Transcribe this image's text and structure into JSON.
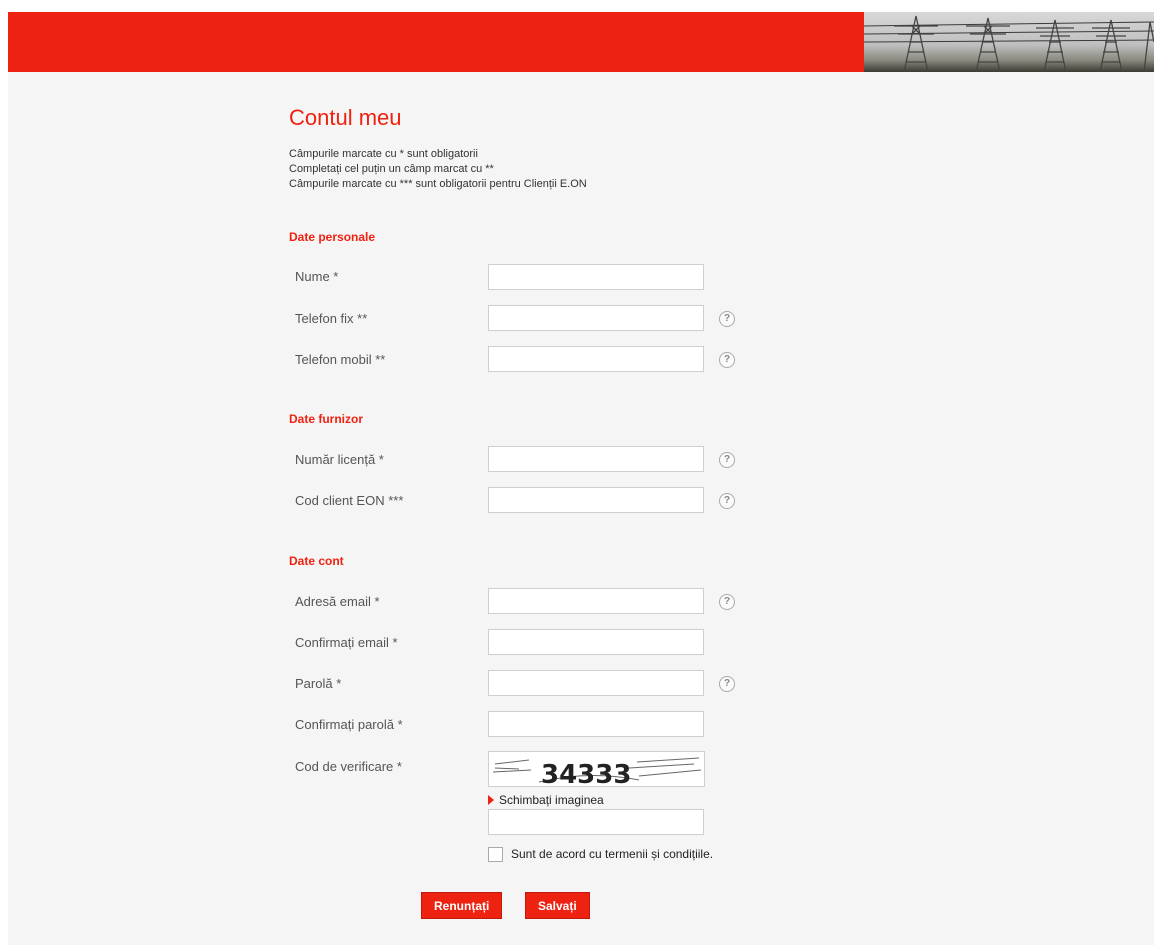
{
  "colors": {
    "brand_red": "#ee2211",
    "page_bg": "#f5f5f5"
  },
  "title": "Contul meu",
  "notes": [
    "Câmpurile marcate cu * sunt obligatorii",
    "Completați cel puțin un câmp marcat cu **",
    "Câmpurile marcate cu *** sunt obligatorii pentru Clienții E.ON"
  ],
  "sections": {
    "personal": "Date personale",
    "supplier": "Date furnizor",
    "account": "Date cont"
  },
  "fields": {
    "nume": {
      "label": "Nume *",
      "value": ""
    },
    "telefon_fix": {
      "label": "Telefon fix **",
      "value": ""
    },
    "telefon_mobil": {
      "label": "Telefon mobil **",
      "value": ""
    },
    "numar_licenta": {
      "label": "Număr licență *",
      "value": ""
    },
    "cod_client": {
      "label": "Cod client EON ***",
      "value": ""
    },
    "email": {
      "label": "Adresă email *",
      "value": ""
    },
    "confirm_email": {
      "label": "Confirmați email *",
      "value": ""
    },
    "parola": {
      "label": "Parolă *",
      "value": ""
    },
    "confirm_parola": {
      "label": "Confirmați parolă *",
      "value": ""
    },
    "cod_verificare": {
      "label": "Cod de verificare *",
      "value": ""
    }
  },
  "help_icon": {
    "name": "question-mark-icon",
    "glyph": "?"
  },
  "captcha": {
    "text": "34333"
  },
  "change_image_label": "Schimbați imaginea",
  "terms_label": "Sunt de acord cu termenii și condițiile.",
  "terms_checked": false,
  "buttons": {
    "cancel": "Renunțați",
    "save": "Salvați"
  }
}
